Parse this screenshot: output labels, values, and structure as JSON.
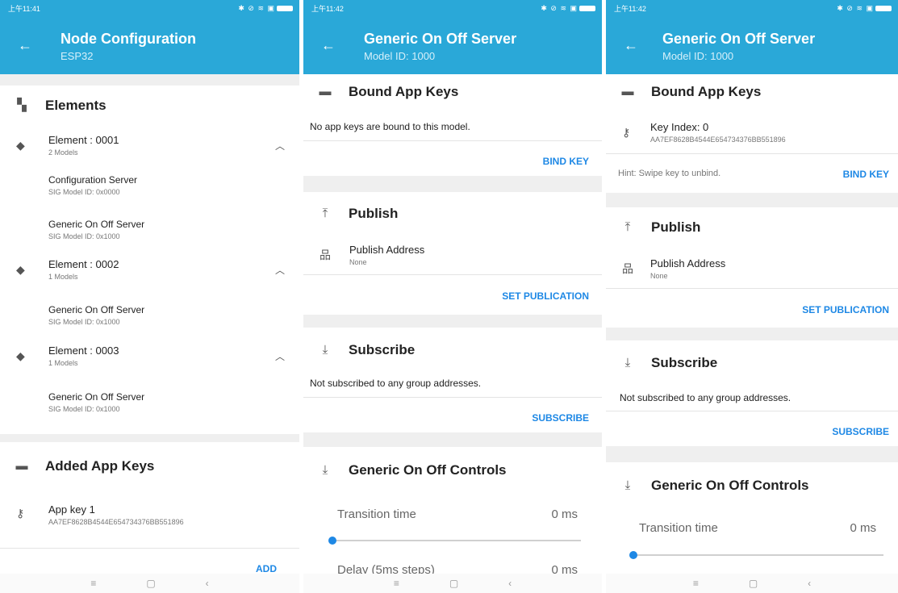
{
  "screen1": {
    "status_time": "上午11:41",
    "status_icons": "✱ ⊘ ≋ ▣",
    "title": "Node Configuration",
    "subtitle": "ESP32",
    "elements_header": "Elements",
    "elements": [
      {
        "name": "Element : 0001",
        "count": "2 Models",
        "models": [
          {
            "name": "Configuration Server",
            "id": "SIG Model ID: 0x0000"
          },
          {
            "name": "Generic On Off Server",
            "id": "SIG Model ID: 0x1000"
          }
        ]
      },
      {
        "name": "Element : 0002",
        "count": "1 Models",
        "models": [
          {
            "name": "Generic On Off Server",
            "id": "SIG Model ID: 0x1000"
          }
        ]
      },
      {
        "name": "Element : 0003",
        "count": "1 Models",
        "models": [
          {
            "name": "Generic On Off Server",
            "id": "SIG Model ID: 0x1000"
          }
        ]
      }
    ],
    "appkeys_header": "Added App Keys",
    "appkey_name": "App key 1",
    "appkey_value": "AA7EF8628B4544E654734376BB551896",
    "add_label": "ADD"
  },
  "screen2": {
    "status_time": "上午11:42",
    "status_icons": "✱ ⊘ ≋ ▣",
    "title": "Generic On Off Server",
    "subtitle": "Model ID: 1000",
    "bound_header": "Bound App Keys",
    "bound_empty": "No app keys are bound to this model.",
    "bind_label": "BIND KEY",
    "publish_header": "Publish",
    "publish_address_label": "Publish Address",
    "publish_address_value": "None",
    "set_publication_label": "SET PUBLICATION",
    "subscribe_header": "Subscribe",
    "subscribe_empty": "Not subscribed to any group addresses.",
    "subscribe_label": "SUBSCRIBE",
    "controls_header": "Generic On Off Controls",
    "transition_label": "Transition time",
    "transition_value": "0 ms",
    "transition_level": 0,
    "delay_label": "Delay (5ms steps)",
    "delay_value": "0 ms"
  },
  "screen3": {
    "status_time": "上午11:42",
    "status_icons": "✱ ⊘ ≋ ▣",
    "title": "Generic On Off Server",
    "subtitle": "Model ID: 1000",
    "bound_header": "Bound App Keys",
    "key_index": "Key Index: 0",
    "key_value": "AA7EF8628B4544E654734376BB551896",
    "hint": "Hint: Swipe key to unbind.",
    "bind_label": "BIND KEY",
    "publish_header": "Publish",
    "publish_address_label": "Publish Address",
    "publish_address_value": "None",
    "set_publication_label": "SET PUBLICATION",
    "subscribe_header": "Subscribe",
    "subscribe_empty": "Not subscribed to any group addresses.",
    "subscribe_label": "SUBSCRIBE",
    "controls_header": "Generic On Off Controls",
    "transition_label": "Transition time",
    "transition_value": "0 ms",
    "transition_level": 0
  },
  "navbar": {
    "menu": "≡",
    "home": "▢",
    "back": "‹"
  },
  "colors": {
    "appbar": "#2aa8d8",
    "accent": "#1e88e5"
  }
}
